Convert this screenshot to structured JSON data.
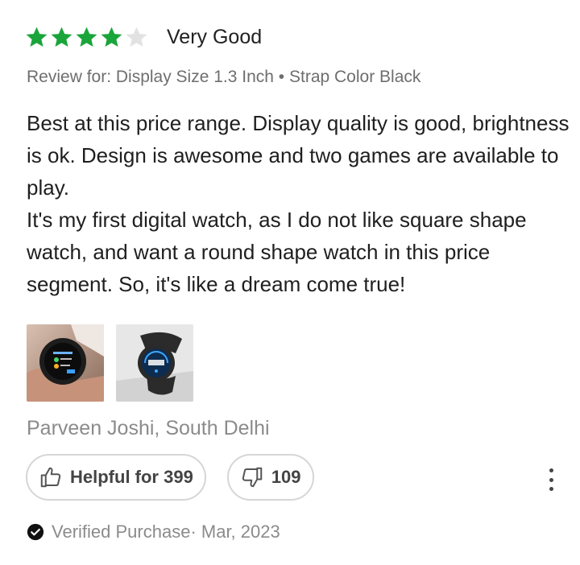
{
  "rating": {
    "value": 4,
    "max": 5,
    "label": "Very Good",
    "filled_color": "#1aa53a",
    "empty_color": "#e2e2e2"
  },
  "review_for": "Review for: Display Size 1.3 Inch • Strap Color Black",
  "body": [
    "Best at this price range. Display quality is good, brightness is ok. Design is awesome and two games are available to play.",
    "It's my first digital watch, as I do not like square shape watch, and  want a round shape watch in this price segment. So, it's like a dream come true!"
  ],
  "photos": [
    {
      "icon": "smartwatch-photo-hand"
    },
    {
      "icon": "smartwatch-photo-table"
    }
  ],
  "reviewer": "Parveen Joshi, South Delhi",
  "votes": {
    "helpful_label": "Helpful for 399",
    "helpful_icon": "thumbs-up-icon",
    "dislike_count": "109",
    "dislike_icon": "thumbs-down-icon"
  },
  "more_icon": "more-vertical-icon",
  "verified": {
    "label": "Verified Purchase",
    "date": "· Mar, 2023",
    "icon": "check-circle-icon"
  }
}
